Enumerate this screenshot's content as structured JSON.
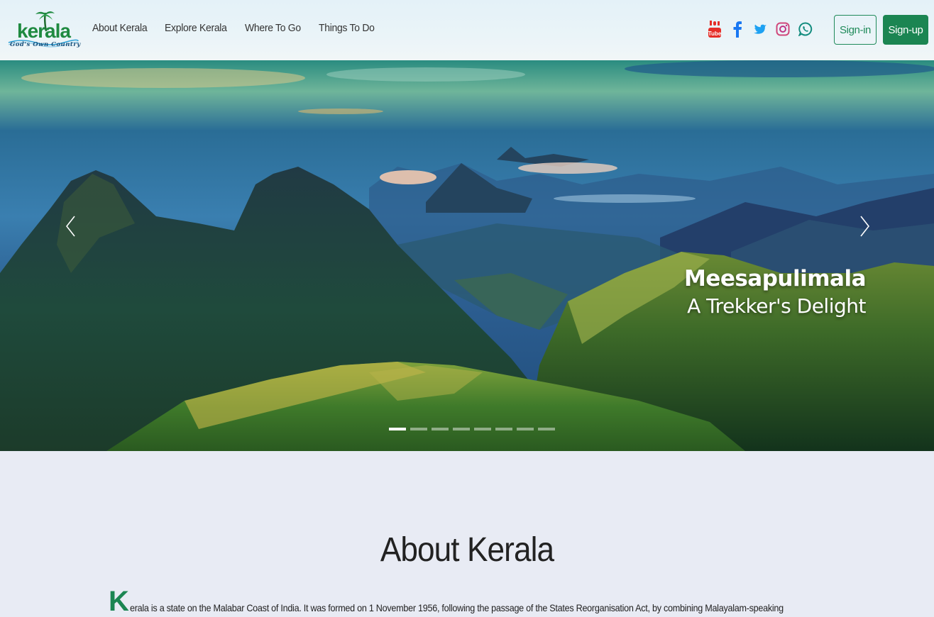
{
  "header": {
    "logo": {
      "word": "kerala",
      "tagline": "God's Own Country",
      "icon": "palm-tree-logo"
    },
    "nav": [
      {
        "label": "About Kerala"
      },
      {
        "label": "Explore Kerala"
      },
      {
        "label": "Where To Go"
      },
      {
        "label": "Things To Do"
      }
    ],
    "social": [
      {
        "icon": "youtube-icon",
        "color": "#e52d27"
      },
      {
        "icon": "facebook-icon",
        "color": "#1877f2"
      },
      {
        "icon": "twitter-icon",
        "color": "#1da1f2"
      },
      {
        "icon": "instagram-icon",
        "color": "#c13584"
      },
      {
        "icon": "whatsapp-icon",
        "color": "#128c7e"
      }
    ],
    "signin_label": "Sign-in",
    "signup_label": "Sign-up",
    "accent": "#1b8552"
  },
  "hero": {
    "slide_title": "Meesapulimala",
    "slide_subtitle": "A Trekker's Delight",
    "slide_count": 8,
    "active_slide": 1,
    "prev_icon": "chevron-left-icon",
    "next_icon": "chevron-right-icon"
  },
  "about": {
    "title": "About Kerala",
    "dropcap": "K",
    "text": "erala is a state on the Malabar Coast of India. It was formed on 1 November 1956, following the passage of the States Reorganisation Act, by combining Malayalam-speaking"
  }
}
